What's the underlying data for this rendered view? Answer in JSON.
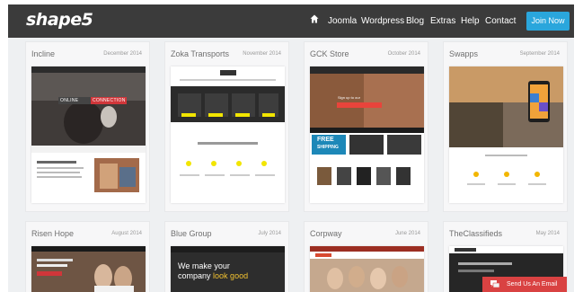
{
  "header": {
    "logo_text": "shape5",
    "nav_links": [
      "Joomla",
      "Wordpress",
      "Blog",
      "Extras",
      "Help",
      "Contact"
    ],
    "join_button": "Join Now",
    "home_icon": "home-icon",
    "bg_color": "#3b3b3b",
    "accent_color": "#2aa6dc"
  },
  "templates": [
    {
      "name": "Incline",
      "date": "December 2014"
    },
    {
      "name": "Zoka Transports",
      "date": "November 2014"
    },
    {
      "name": "GCK Store",
      "date": "October 2014"
    },
    {
      "name": "Swapps",
      "date": "September 2014"
    },
    {
      "name": "Risen Hope",
      "date": "August 2014"
    },
    {
      "name": "Blue Group",
      "date": "July 2014"
    },
    {
      "name": "Corpway",
      "date": "June 2014"
    },
    {
      "name": "TheClassifieds",
      "date": "May 2014"
    }
  ],
  "thumbnails": {
    "incline_banner": [
      "ONLINE",
      "CONNECTION"
    ],
    "gck_store_banner": "Sign up to our",
    "gck_store_badge": [
      "FREE",
      "SHIPPING"
    ],
    "blue_group_text": [
      "We make your",
      "company",
      "look good"
    ]
  },
  "chat": {
    "label": "Send Us An Email",
    "icon": "chat-bubble-icon",
    "color": "#d94242"
  }
}
